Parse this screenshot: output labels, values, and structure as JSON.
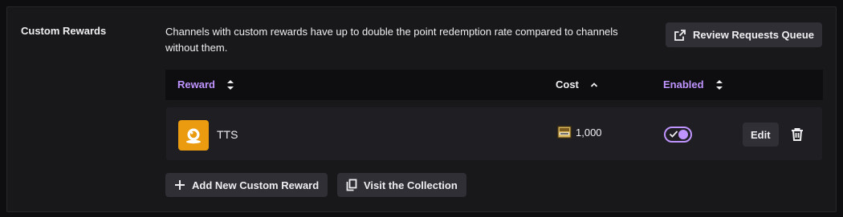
{
  "section": {
    "title": "Custom Rewards",
    "description": "Channels with custom rewards have up to double the point redemption rate compared to channels without them."
  },
  "buttons": {
    "review_queue": "Review Requests Queue",
    "add_reward": "Add New Custom Reward",
    "visit_collection": "Visit the Collection",
    "edit": "Edit"
  },
  "table": {
    "columns": [
      "Reward",
      "Cost",
      "Enabled"
    ],
    "rows": [
      {
        "name": "TTS",
        "cost": "1,000",
        "enabled": true
      }
    ]
  },
  "colors": {
    "accent": "#bf94ff",
    "reward_icon_bg": "#ea9b10",
    "button_bg": "#2f2f35",
    "panel_bg": "#18181b"
  },
  "icons": [
    "external-link-icon",
    "sort-icon",
    "sort-up-icon",
    "reward-icon",
    "channel-points-icon",
    "check-icon",
    "trash-icon",
    "plus-icon",
    "copy-icon"
  ]
}
